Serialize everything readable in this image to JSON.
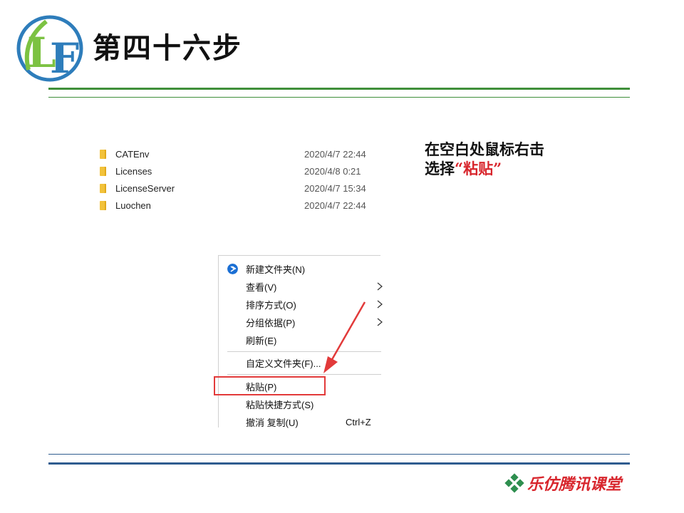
{
  "slide": {
    "title": "第四十六步",
    "logo_text": "LF",
    "instruction": {
      "line1": "在空白处鼠标右击",
      "line2_prefix": "选择",
      "line2_highlight": "“粘贴”"
    },
    "brand": "乐仿腾讯课堂"
  },
  "explorer": {
    "files": [
      {
        "name": "CATEnv",
        "date": "2020/4/7 22:44",
        "icon": "folder-icon"
      },
      {
        "name": "Licenses",
        "date": "2020/4/8 0:21",
        "icon": "folder-icon"
      },
      {
        "name": "LicenseServer",
        "date": "2020/4/7 15:34",
        "icon": "folder-icon"
      },
      {
        "name": "Luochen",
        "date": "2020/4/7 22:44",
        "icon": "folder-icon"
      }
    ]
  },
  "context_menu": {
    "items": [
      {
        "label": "新建文件夹(N)",
        "icon": "new-folder-icon"
      },
      {
        "label": "查看(V)",
        "submenu": true
      },
      {
        "label": "排序方式(O)",
        "submenu": true
      },
      {
        "label": "分组依据(P)",
        "submenu": true
      },
      {
        "label": "刷新(E)"
      },
      {
        "label": "自定义文件夹(F)..."
      },
      {
        "label": "粘贴(P)",
        "highlighted": true
      },
      {
        "label": "粘贴快捷方式(S)"
      },
      {
        "label": "撤消 复制(U)",
        "shortcut": "Ctrl+Z"
      }
    ]
  },
  "colors": {
    "accent_red": "#d8262d",
    "rule_green": "#3f8f3a",
    "rule_blue": "#2f5c8f",
    "folder_yellow": "#f2c23a"
  }
}
